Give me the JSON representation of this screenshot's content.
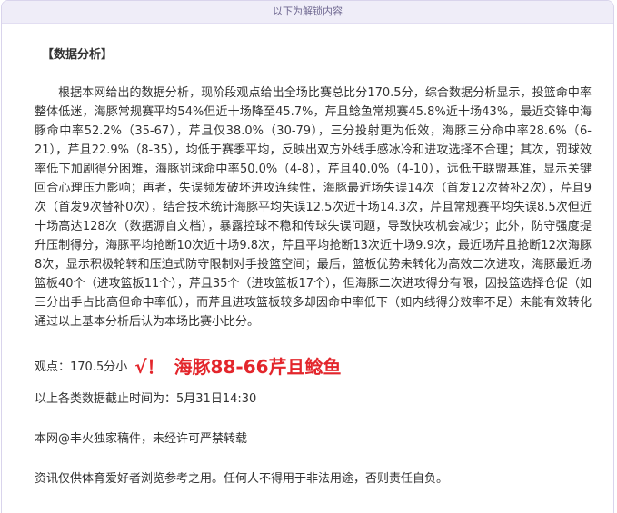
{
  "banner": {
    "text": "以下为解锁内容"
  },
  "article": {
    "section_title": "【数据分析】",
    "analysis": "根据本网给出的数据分析，现阶段观点给出全场比赛总比分170.5分，综合数据分析显示，投篮命中率整体低迷，海豚常规赛平均54%但近十场降至45.7%，芹且鲶鱼常规赛45.8%近十场43%，最近交锋中海豚命中率52.2%（35-67），芹且仅38.0%（30-79），三分投射更为低效，海豚三分命中率28.6%（6-21），芹且22.9%（8-35），均低于赛季平均，反映出双方外线手感冰冷和进攻选择不合理；其次，罚球效率低下加剧得分困难，海豚罚球命中率50.0%（4-8），芹且40.0%（4-10），远低于联盟基准，显示关键回合心理压力影响；再者，失误频发破坏进攻连续性，海豚最近场失误14次（首发12次替补2次），芹且9次（首发9次替补0次），结合技术统计海豚平均失误12.5次近十场14.3次，芹且常规赛平均失误8.5次但近十场高达128次（数据源自文档），暴露控球不稳和传球失误问题，导致快攻机会减少；此外，防守强度提升压制得分，海豚平均抢断10次近十场9.8次，芹且平均抢断13次近十场9.9次，最近场芹且抢断12次海豚8次，显示积极轮转和压迫式防守限制对手投篮空间；最后，篮板优势未转化为高效二次进攻，海豚最近场篮板40个（进攻篮板11个），芹且35个（进攻篮板17个），但海豚二次进攻得分有限，因投篮选择仓促（如三分出手占比高但命中率低），而芹且进攻篮板较多却因命中率低下（如内线得分效率不足）未能有效转化通过以上基本分析后认为本场比赛小比分。",
    "verdict_label": "观点：170.5分小",
    "verdict_check": "√！",
    "verdict_result": "海豚88-66芹且鲶鱼",
    "cutoff": "以上各类数据截止时间为：5月31日14:30",
    "copyright": "本网@丰火独家稿件，未经许可严禁转载",
    "disclaimer": "资讯仅供体育爱好者浏览参考之用。任何人不得用于非法用途，否则责任自负。"
  },
  "colors": {
    "accent_red": "#e3262c",
    "banner_bg": "#efedf8",
    "banner_text": "#6f6891",
    "body_text": "#333333"
  }
}
